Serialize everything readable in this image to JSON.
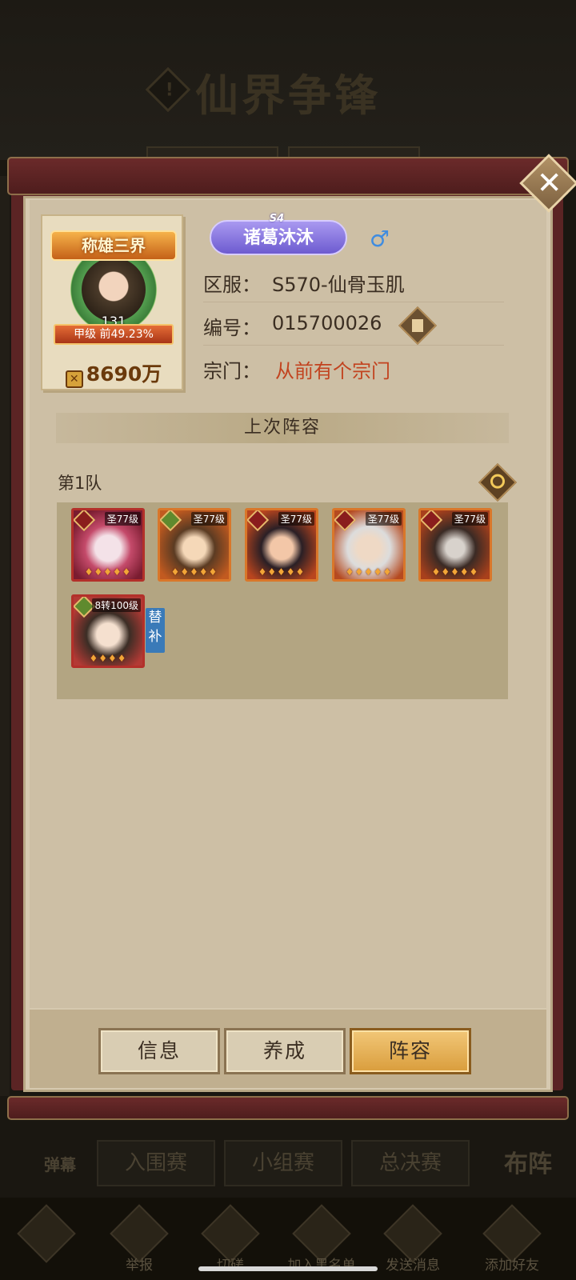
{
  "background": {
    "title": "仙界争锋",
    "stage_tabs": [
      "入围赛",
      "小组赛",
      "总决赛"
    ],
    "danmaku_label": "弹幕",
    "formation_label": "布阵",
    "bottom_bar": [
      "",
      "举报",
      "切磋",
      "加入黑名单",
      "发送消息",
      "添加好友"
    ]
  },
  "profile": {
    "title_badge": "称雄三界",
    "level": "131",
    "rank": "甲级 前49.23%",
    "power": "8690万",
    "season": "S4",
    "name": "诸葛沐沐",
    "gender": "♂",
    "server_label": "区服：",
    "server_value": "S570-仙骨玉肌",
    "id_label": "编号：",
    "id_value": "015700026",
    "sect_label": "宗门：",
    "sect_value": "从前有个宗门"
  },
  "lineup": {
    "section_title": "上次阵容",
    "team_label": "第1队",
    "heroes": [
      {
        "level": "圣77级",
        "stars": "♦♦♦♦♦",
        "frame": "red"
      },
      {
        "level": "圣77级",
        "stars": "♦♦♦♦♦",
        "frame": "orange"
      },
      {
        "level": "圣77级",
        "stars": "♦♦♦♦♦",
        "frame": "orange"
      },
      {
        "level": "圣77级",
        "stars": "♦♦♦♦♦",
        "frame": "orange"
      },
      {
        "level": "圣77级",
        "stars": "♦♦♦♦♦",
        "frame": "orange"
      }
    ],
    "substitute": {
      "level": "8转100级",
      "stars": "♦♦♦♦",
      "tag": "替补"
    }
  },
  "tabs": {
    "info": "信息",
    "develop": "养成",
    "lineup": "阵容"
  },
  "colors": {
    "accent_red": "#c2431f",
    "scroll": "#5b2424",
    "parchment": "#d6c9b0",
    "active_tab": "#e8b45a"
  }
}
